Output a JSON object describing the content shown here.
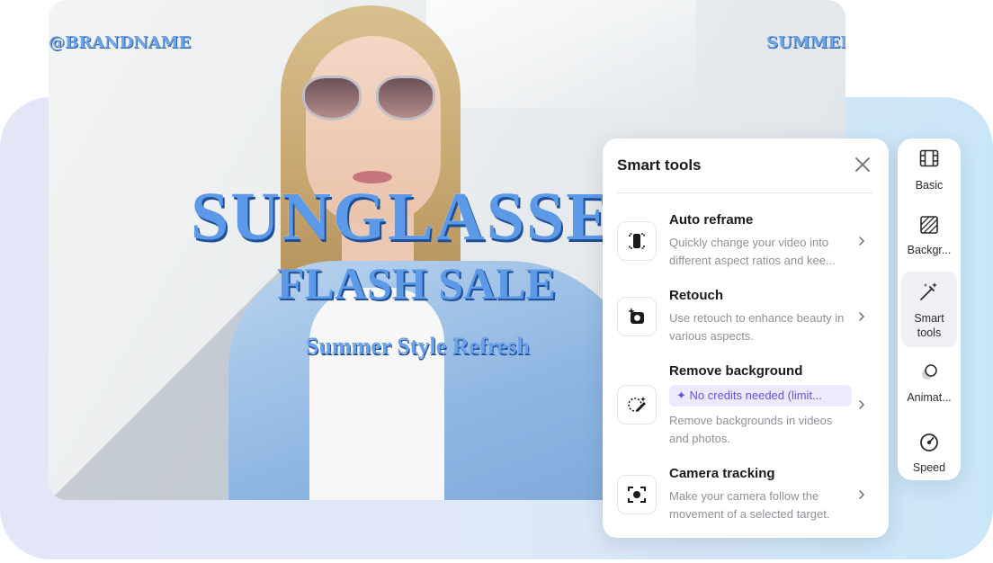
{
  "video": {
    "brand_left": "@BRANDNAME",
    "brand_right": "SUMMER",
    "headline": "SUNGLASSES",
    "sub_headline": "FLASH SALE",
    "tagline": "Summer Style Refresh"
  },
  "panel": {
    "title": "Smart tools",
    "close_icon": "close-icon",
    "tools": [
      {
        "name": "Auto reframe",
        "icon": "reframe-icon",
        "desc": "Quickly change your video into different aspect ratios and kee..."
      },
      {
        "name": "Retouch",
        "icon": "retouch-icon",
        "desc": "Use retouch to enhance beauty in various aspects."
      },
      {
        "name": "Remove background",
        "icon": "remove-background-icon",
        "badge": "✦ No credits needed (limit...",
        "desc": "Remove backgrounds in videos and photos."
      },
      {
        "name": "Camera tracking",
        "icon": "camera-tracking-icon",
        "desc": "Make your camera follow the movement of a selected target."
      }
    ]
  },
  "rail": {
    "items": [
      {
        "label": "Basic",
        "icon": "film-icon"
      },
      {
        "label": "Backgr...",
        "icon": "background-icon"
      },
      {
        "label": "Smart tools",
        "icon": "magic-wand-icon"
      },
      {
        "label": "Animat...",
        "icon": "animation-icon"
      },
      {
        "label": "Speed",
        "icon": "speed-icon"
      }
    ]
  },
  "colors": {
    "accent_purple": "#6b4ce6",
    "badge_bg": "#eeeafd",
    "headline_blue": "#5c9ae8"
  }
}
